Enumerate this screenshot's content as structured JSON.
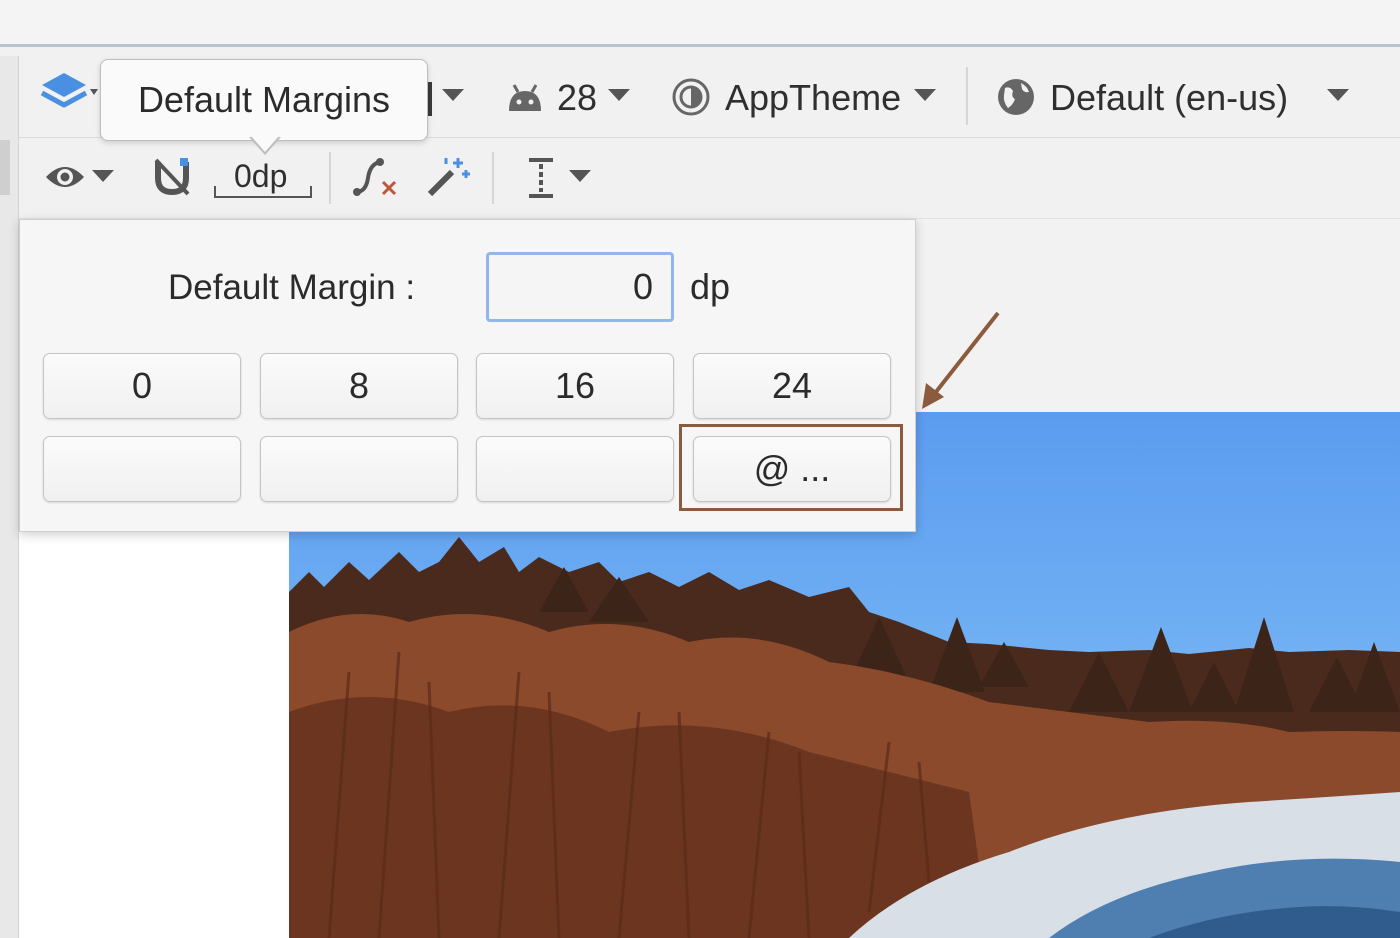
{
  "toolbar": {
    "api_level": "28",
    "theme": "AppTheme",
    "locale": "Default (en-us)",
    "margin_value": "0dp"
  },
  "tooltip": {
    "text": "Default Margins"
  },
  "popup": {
    "label": "Default Margin :",
    "input_value": "0",
    "unit": "dp",
    "preset_buttons": [
      "0",
      "8",
      "16",
      "24"
    ],
    "blank_buttons": [
      "",
      "",
      ""
    ],
    "resource_button": "@ ..."
  },
  "colors": {
    "annotation": "#8c5a3c",
    "input_focus": "#93b7ec",
    "layers_icon": "#4a90e2"
  }
}
